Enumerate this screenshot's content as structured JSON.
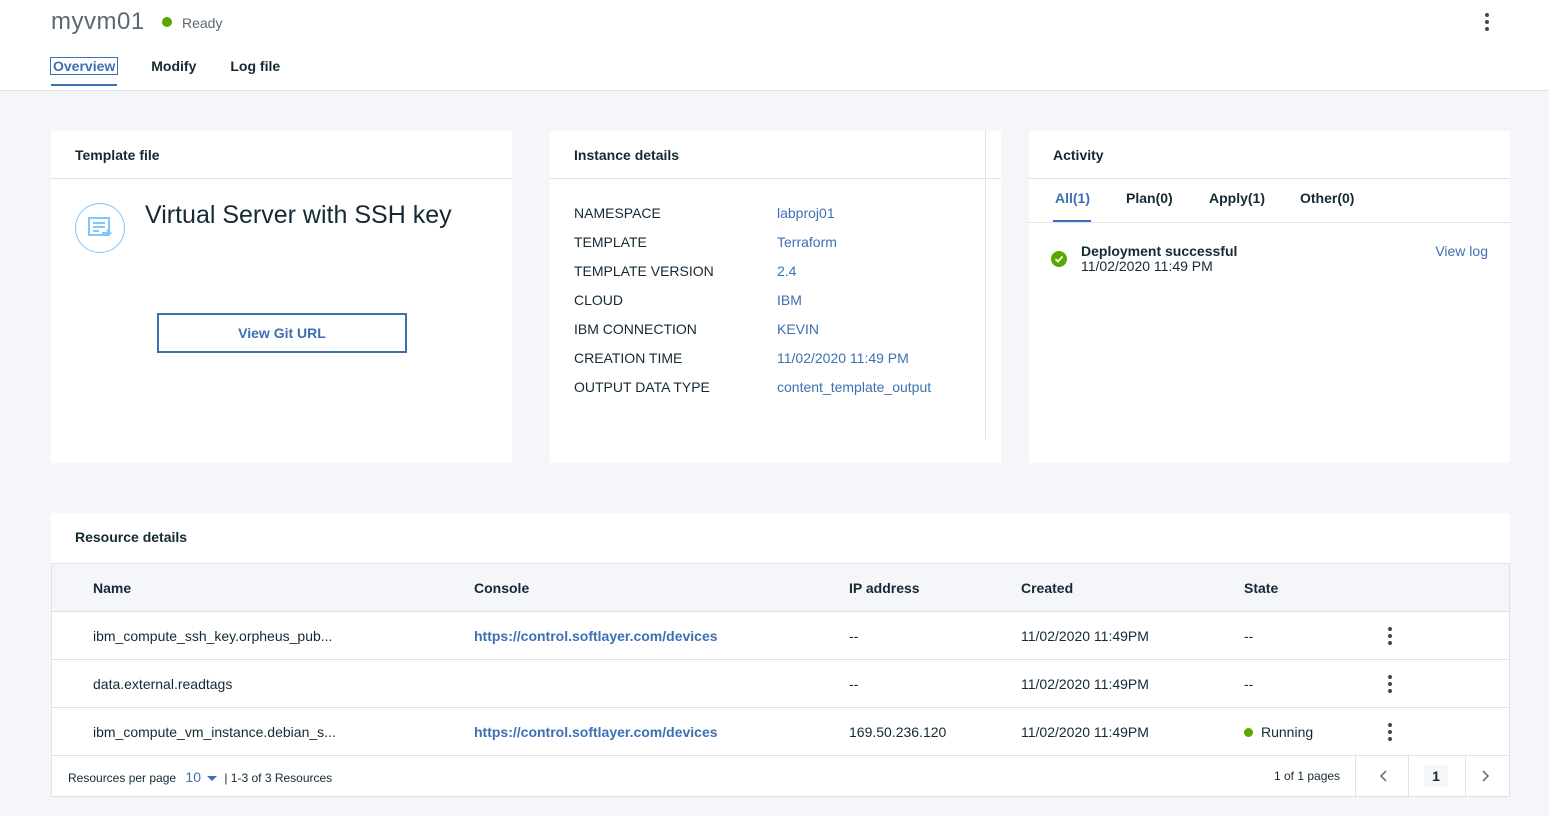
{
  "header": {
    "title": "myvm01",
    "status": "Ready",
    "tabs": [
      "Overview",
      "Modify",
      "Log file"
    ]
  },
  "template_card": {
    "heading": "Template file",
    "template_name": "Virtual Server with SSH key",
    "git_button": "View Git URL"
  },
  "instance_card": {
    "heading": "Instance details",
    "rows": [
      {
        "key": "NAMESPACE",
        "value": "labproj01"
      },
      {
        "key": "TEMPLATE",
        "value": "Terraform"
      },
      {
        "key": "TEMPLATE VERSION",
        "value": "2.4"
      },
      {
        "key": "CLOUD",
        "value": "IBM"
      },
      {
        "key": "IBM CONNECTION",
        "value": "KEVIN"
      },
      {
        "key": "CREATION TIME",
        "value": "11/02/2020 11:49 PM"
      },
      {
        "key": "OUTPUT DATA TYPE",
        "value": "content_template_output"
      }
    ]
  },
  "activity_card": {
    "heading": "Activity",
    "tabs": [
      "All(1)",
      "Plan(0)",
      "Apply(1)",
      "Other(0)"
    ],
    "event_title": "Deployment successful",
    "event_date": "11/02/2020 11:49 PM",
    "view_log": "View log"
  },
  "resources": {
    "heading": "Resource details",
    "columns": [
      "Name",
      "Console",
      "IP address",
      "Created",
      "State"
    ],
    "rows": [
      {
        "name": "ibm_compute_ssh_key.orpheus_pub...",
        "console": "https://control.softlayer.com/devices",
        "ip": "--",
        "created": "11/02/2020 11:49PM",
        "state": "--"
      },
      {
        "name": "data.external.readtags",
        "console": "",
        "ip": "--",
        "created": "11/02/2020 11:49PM",
        "state": "--"
      },
      {
        "name": "ibm_compute_vm_instance.debian_s...",
        "console": "https://control.softlayer.com/devices",
        "ip": "169.50.236.120",
        "created": "11/02/2020 11:49PM",
        "state": "Running"
      }
    ],
    "pagination": {
      "per_page_label": "Resources per page",
      "per_page": "10",
      "range": "| 1-3 of 3 Resources",
      "pages": "1 of 1 pages",
      "current": "1"
    }
  },
  "colors": {
    "accent": "#3d70b2",
    "success": "#5aa700",
    "background": "#f4f6f9"
  }
}
